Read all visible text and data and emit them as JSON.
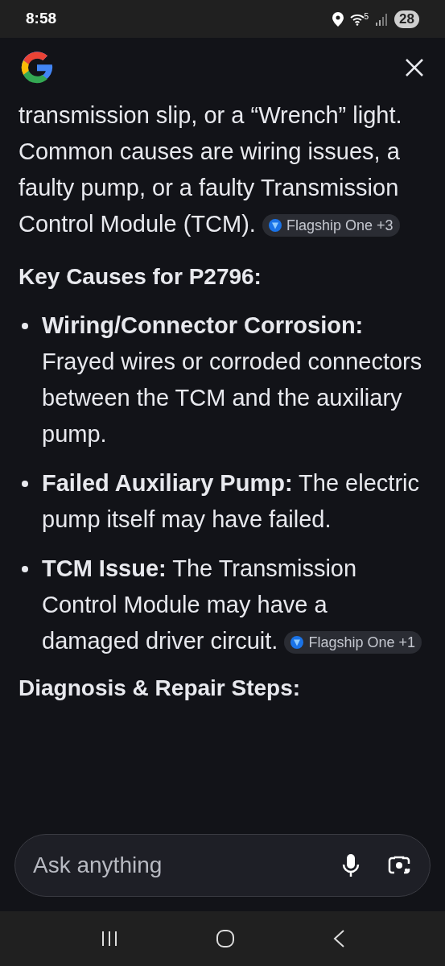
{
  "status_bar": {
    "time": "8:58",
    "battery": "28",
    "wifi_badge": "5"
  },
  "answer": {
    "intro": {
      "text": "transmission slip, or a “Wrench” light. Common causes are wiring issues, a faulty pump, or a faulty Transmission Control Module (TCM).",
      "source_chip": "Flagship One +3"
    },
    "heading": "Key Causes for P2796:",
    "bullets": [
      {
        "text": "**Wiring/Connector Corrosion:** Frayed wires or corroded connectors between the TCM and the auxiliary pump."
      },
      {
        "text": "**Failed Auxiliary Pump:** The electric pump itself may have failed."
      },
      {
        "text": "**TCM Issue:** The Transmission Control Module may have a damaged driver circuit.",
        "source_chip": "Flagship One +1"
      }
    ],
    "next_heading": "Diagnosis & Repair Steps:"
  },
  "ask_field": {
    "placeholder": "Ask anything"
  }
}
